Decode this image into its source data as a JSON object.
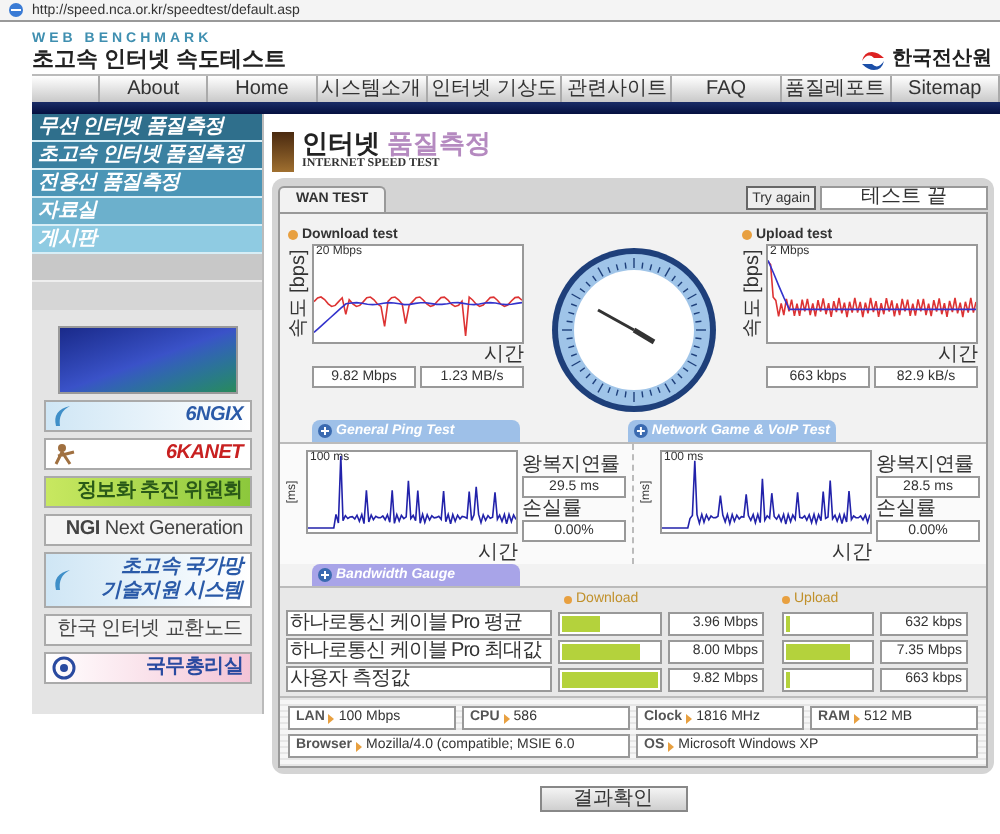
{
  "address_bar": {
    "url": "http://speed.nca.or.kr/speedtest/default.asp"
  },
  "header": {
    "brand_top": "WEB BENCHMARK",
    "brand_title": "초고속 인터넷 속도테스트",
    "org_name": "한국전산원"
  },
  "nav": [
    "About",
    "Home",
    "시스템소개",
    "인터넷 기상도",
    "관련사이트",
    "FAQ",
    "품질레포트",
    "Sitemap"
  ],
  "sidebar": {
    "menu": [
      "무선 인터넷 품질측정",
      "초고속 인터넷 품질측정",
      "전용선 품질측정",
      "자료실",
      "게시판"
    ],
    "banners": [
      {
        "kind": "photo"
      },
      {
        "kind": "swoosh",
        "lines": [
          "6NGIX"
        ]
      },
      {
        "kind": "figure",
        "lines": [
          "6KANET"
        ]
      },
      {
        "kind": "leaf",
        "lines": [
          "정보화 추진 위원회"
        ]
      },
      {
        "kind": "plain",
        "lines": [
          "**NGI** Next Generation"
        ]
      },
      {
        "kind": "swoosh",
        "lines": [
          "초고속 국가망",
          "기술지원 시스템"
        ]
      },
      {
        "kind": "plain",
        "lines": [
          "한국 인터넷 교환노드"
        ]
      },
      {
        "kind": "emblem",
        "lines": [
          "국무총리실"
        ]
      }
    ]
  },
  "page_title": {
    "title": [
      "인터넷",
      "품질측정"
    ],
    "subtitle": "INTERNET SPEED TEST"
  },
  "test": {
    "tab": "WAN TEST",
    "try_again": "Try again",
    "status": "테스트 끝",
    "speed": [
      {
        "label": "Download test",
        "axis": "속도 [bps]",
        "scale": "20 Mbps",
        "time_label": "시간",
        "readings": [
          "9.82 Mbps",
          "1.23 MB/s"
        ]
      },
      {
        "label": "Upload test",
        "axis": "속도 [bps]",
        "scale": "2 Mbps",
        "time_label": "시간",
        "readings": [
          "663 kbps",
          "82.9 kB/s"
        ]
      }
    ],
    "ping_tabs": [
      "General Ping Test",
      "Network Game & VoIP Test"
    ],
    "ping": [
      {
        "axis": "[ms]",
        "scale": "100 ms",
        "rtt_label": "왕복지연률",
        "rtt": "29.5 ms",
        "loss_label": "손실률",
        "loss": "0.00%",
        "time_label": "시간"
      },
      {
        "axis": "[ms]",
        "scale": "100 ms",
        "rtt_label": "왕복지연률",
        "rtt": "28.5 ms",
        "loss_label": "손실률",
        "loss": "0.00%",
        "time_label": "시간"
      }
    ],
    "bandwidth": {
      "tab": "Bandwidth Gauge",
      "download_header": "Download",
      "upload_header": "Upload",
      "rows": [
        {
          "name": "하나로통신 케이블 Pro 평균",
          "download": {
            "level": 0.4,
            "value": "3.96 Mbps"
          },
          "upload": {
            "level": 0.05,
            "value": "632 kbps"
          }
        },
        {
          "name": "하나로통신 케이블 Pro 최대값",
          "download": {
            "level": 0.81,
            "value": "8.00 Mbps"
          },
          "upload": {
            "level": 0.75,
            "value": "7.35 Mbps"
          }
        },
        {
          "name": "사용자 측정값",
          "download": {
            "level": 0.99,
            "value": "9.82 Mbps"
          },
          "upload": {
            "level": 0.05,
            "value": "663 kbps"
          }
        }
      ]
    },
    "system": [
      [
        {
          "label": "LAN",
          "value": "100 Mbps"
        },
        {
          "label": "CPU",
          "value": "586"
        },
        {
          "label": "Clock",
          "value": "1816 MHz"
        },
        {
          "label": "RAM",
          "value": "512 MB"
        }
      ],
      [
        {
          "label": "Browser",
          "value": "Mozilla/4.0 (compatible; MSIE 6.0"
        },
        {
          "label": "OS",
          "value": "Microsoft Windows XP"
        }
      ]
    ]
  },
  "result_button": "결과확인"
}
